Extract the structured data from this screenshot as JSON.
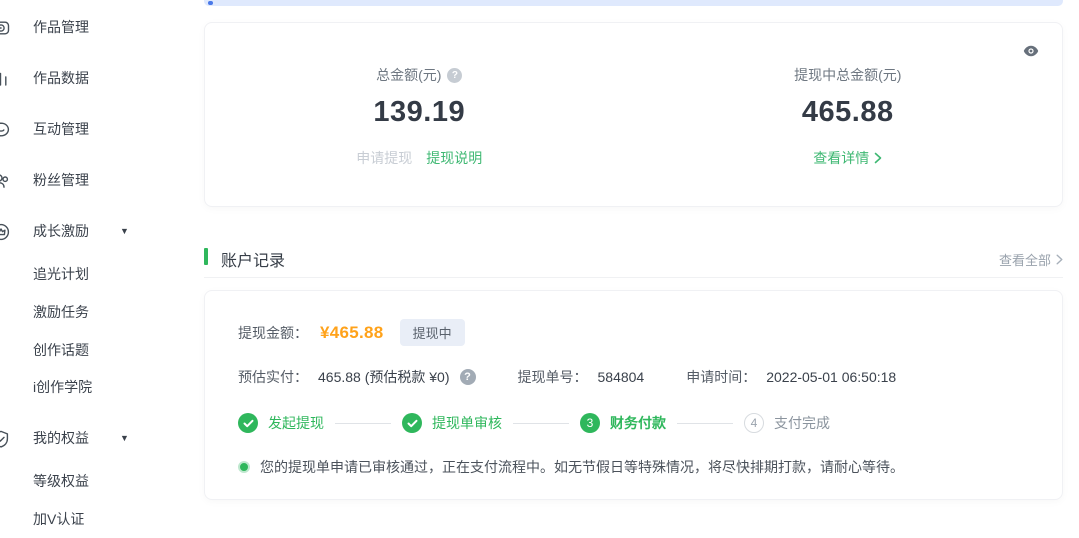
{
  "colors": {
    "accent_green": "#2fb75c",
    "link_green": "#3fb873",
    "amount_orange": "#ffa21a",
    "banner_blue": "#dfe9fd"
  },
  "sidebar": {
    "items": [
      {
        "id": "works-management",
        "label": "作品管理",
        "icon": "play-square",
        "child": false,
        "expandable": false
      },
      {
        "id": "works-data",
        "label": "作品数据",
        "icon": "bar-chart",
        "child": false,
        "expandable": false
      },
      {
        "id": "interaction-management",
        "label": "互动管理",
        "icon": "chat-smile",
        "child": false,
        "expandable": false
      },
      {
        "id": "fans-management",
        "label": "粉丝管理",
        "icon": "users",
        "child": false,
        "expandable": false
      },
      {
        "id": "growth-incentive",
        "label": "成长激励",
        "icon": "medal-crown",
        "child": false,
        "expandable": true
      },
      {
        "id": "light-chasing-plan",
        "label": "追光计划",
        "child": true,
        "expandable": false
      },
      {
        "id": "incentive-tasks",
        "label": "激励任务",
        "child": true,
        "expandable": false
      },
      {
        "id": "creation-topics",
        "label": "创作话题",
        "child": true,
        "expandable": false
      },
      {
        "id": "icreation-academy",
        "label": "i创作学院",
        "child": true,
        "expandable": false
      },
      {
        "id": "my-benefits",
        "label": "我的权益",
        "icon": "shield-check",
        "child": false,
        "expandable": true
      },
      {
        "id": "level-benefits",
        "label": "等级权益",
        "child": true,
        "expandable": false
      },
      {
        "id": "v-verification",
        "label": "加V认证",
        "child": true,
        "expandable": false
      }
    ]
  },
  "summary": {
    "left": {
      "label": "总金额(元)",
      "value": "139.19",
      "apply_label": "申请提现",
      "instructions_label": "提现说明"
    },
    "right": {
      "label": "提现中总金额(元)",
      "value": "465.88",
      "details_label": "查看详情"
    }
  },
  "records": {
    "title": "账户记录",
    "view_all_label": "查看全部",
    "record": {
      "amount_label": "提现金额：",
      "amount": "¥465.88",
      "status_badge": "提现中",
      "estimated_label": "预估实付：",
      "estimated_value": "465.88 (预估税款 ¥0)",
      "order_label": "提现单号：",
      "order_no": "584804",
      "apply_time_label": "申请时间：",
      "apply_time": "2022-05-01 06:50:18",
      "steps": [
        {
          "label": "发起提现",
          "state": "done",
          "num": ""
        },
        {
          "label": "提现单审核",
          "state": "done",
          "num": ""
        },
        {
          "label": "财务付款",
          "state": "current",
          "num": "3"
        },
        {
          "label": "支付完成",
          "state": "todo",
          "num": "4"
        }
      ],
      "status_message": "您的提现单申请已审核通过，正在支付流程中。如无节假日等特殊情况，将尽快排期打款，请耐心等待。"
    }
  }
}
